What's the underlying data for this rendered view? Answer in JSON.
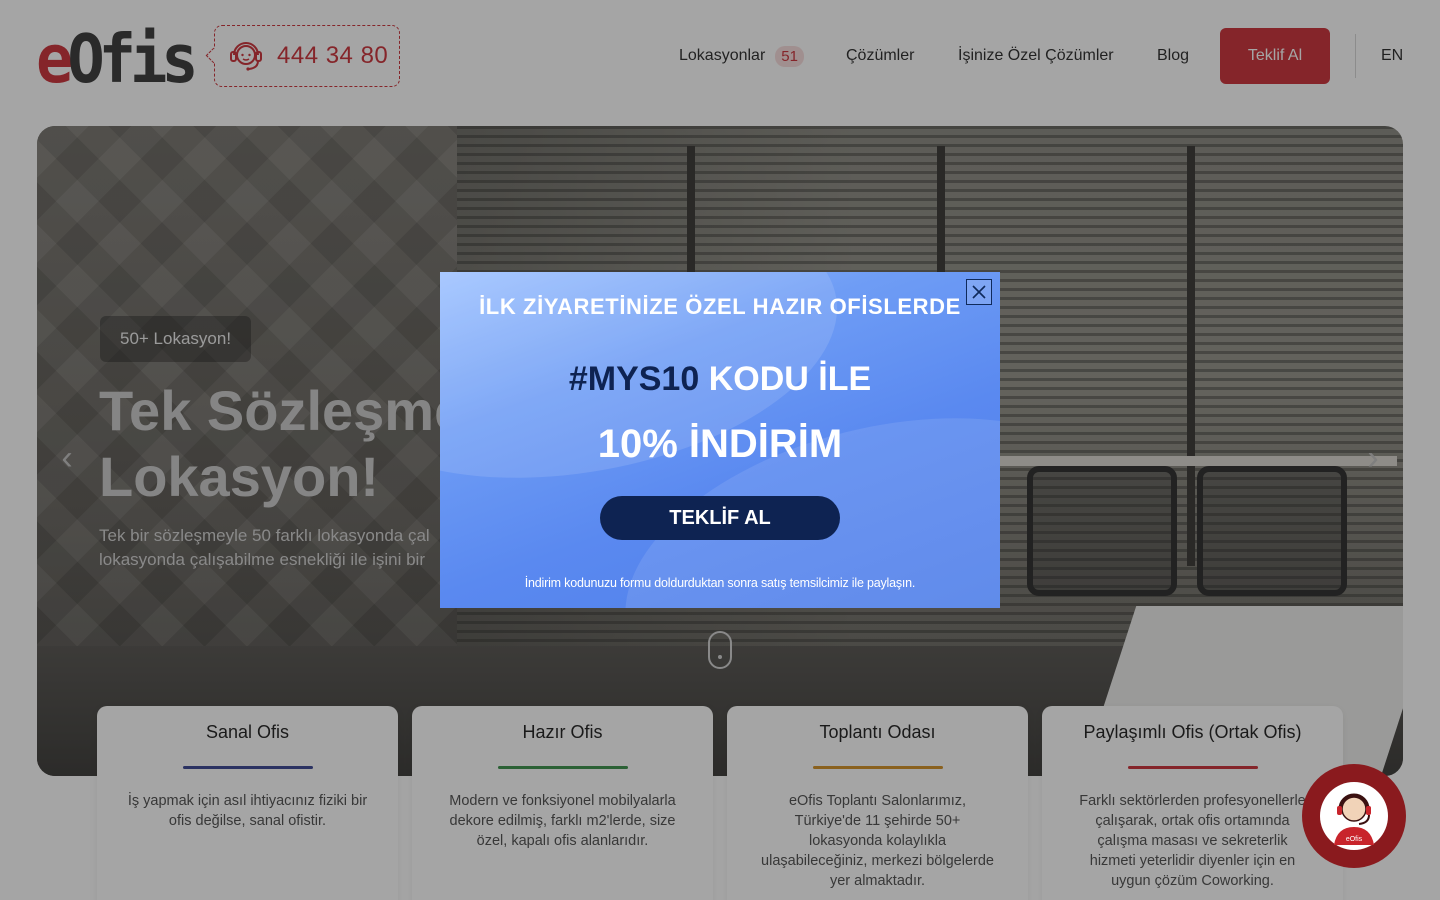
{
  "header": {
    "logo_e": "e",
    "logo_rest": "Ofis",
    "phone": "444 34 80",
    "nav": {
      "locations_label": "Lokasyonlar",
      "locations_count": "51",
      "solutions_label": "Çözümler",
      "custom_solutions_label": "İşinize Özel Çözümler",
      "blog_label": "Blog"
    },
    "cta_label": "Teklif Al",
    "lang_label": "EN"
  },
  "hero": {
    "pill": "50+ Lokasyon!",
    "title_line1": "Tek Sözleşme",
    "title_line2": "Lokasyon!",
    "desc_line1": "Tek bir sözleşmeyle 50 farklı lokasyonda çal",
    "desc_line2": "lokasyonda çalışabilme esnekliği ile işini bir"
  },
  "cards": [
    {
      "title": "Sanal Ofis",
      "text": "İş yapmak için asıl ihtiyacınız fiziki bir ofis değilse, sanal ofistir.",
      "accent": "#2d3a8c"
    },
    {
      "title": "Hazır Ofis",
      "text": "Modern ve fonksiyonel mobilyalarla dekore edilmiş, farklı m2'lerde, size özel, kapalı ofis alanlarıdır.",
      "accent": "#2e8b3e"
    },
    {
      "title": "Toplantı Odası",
      "text": "eOfis Toplantı Salonlarımız, Türkiye'de 11 şehirde 50+ lokasyonda kolaylıkla ulaşabileceğiniz, merkezi bölgelerde yer almaktadır.",
      "accent": "#d08a18"
    },
    {
      "title": "Paylaşımlı Ofis (Ortak Ofis)",
      "text": "Farklı sektörlerden profesyonellerle çalışarak, ortak ofis ortamında çalışma masası ve sekreterlik hizmeti yeterlidir diyenler için en uygun çözüm Coworking.",
      "accent": "#c8242b"
    }
  ],
  "modal": {
    "heading": "İLK ZİYARETİNİZE ÖZEL HAZIR OFİSLERDE",
    "code": "#MYS10",
    "code_suffix": " KODU İLE",
    "discount": "10% İNDİRİM",
    "button_label": "TEKLİF AL",
    "note": "İndirim kodunuzu formu doldurduktan sonra satış temsilcimiz ile paylaşın."
  },
  "support": {
    "icon_label": "eOfis"
  },
  "colors": {
    "brand_red": "#c8242b",
    "modal_navy": "#0e2352",
    "modal_blue": "#5a89f0"
  },
  "icons": [
    "headset-icon",
    "chevron-left-icon",
    "chevron-right-icon",
    "scroll-mouse-icon",
    "close-icon",
    "support-agent-icon"
  ]
}
